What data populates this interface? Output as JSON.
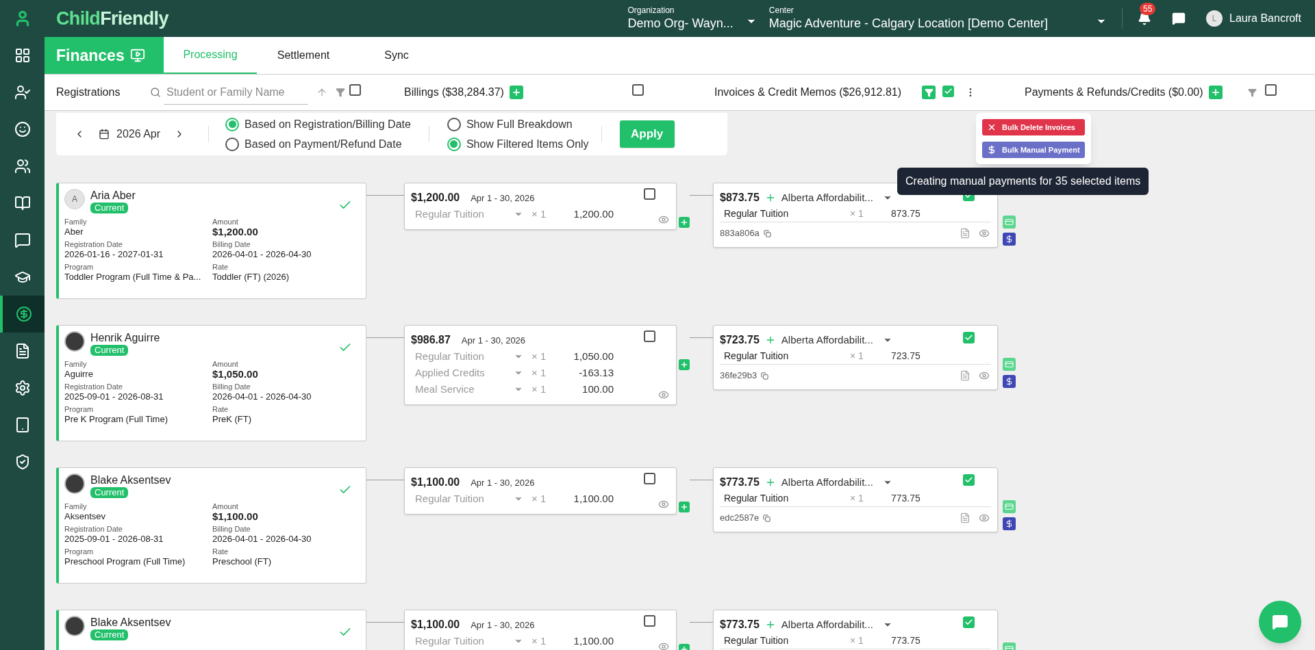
{
  "header": {
    "logo": {
      "first": "Child",
      "second": "Friendly"
    },
    "organization": {
      "label": "Organization",
      "value": "Demo Org- Wayn..."
    },
    "center": {
      "label": "Center",
      "value": "Magic Adventure - Calgary Location [Demo Center]"
    },
    "notifications": "55",
    "user": {
      "initial": "L",
      "name": "Laura Bancroft"
    }
  },
  "sidebar": {
    "items": [
      {
        "kind": "grid",
        "selected": false
      },
      {
        "kind": "user-check",
        "selected": false
      },
      {
        "kind": "smile",
        "selected": false
      },
      {
        "kind": "users",
        "selected": false
      },
      {
        "kind": "book",
        "selected": false
      },
      {
        "kind": "chat",
        "selected": false
      },
      {
        "kind": "graduation",
        "selected": false
      },
      {
        "kind": "dollar",
        "selected": true
      },
      {
        "kind": "document",
        "selected": false
      },
      {
        "kind": "settings",
        "selected": false
      },
      {
        "kind": "tablet",
        "selected": false
      },
      {
        "kind": "shield",
        "selected": false
      }
    ]
  },
  "section": {
    "title": "Finances",
    "tabs": [
      {
        "label": "Processing",
        "selected": true
      },
      {
        "label": "Settlement",
        "selected": false
      },
      {
        "label": "Sync",
        "selected": false
      }
    ]
  },
  "columns": {
    "registrations": {
      "title": "Registrations",
      "search_placeholder": "Student or Family Name",
      "checked": false
    },
    "billings": {
      "title": "Billings ($38,284.37)",
      "checked": false
    },
    "invoices": {
      "title": "Invoices & Credit Memos ($26,912.81)",
      "filter_active": true,
      "checked": true
    },
    "payments": {
      "title": "Payments & Refunds/Credits ($0.00)",
      "filter_active": false,
      "checked": false
    }
  },
  "filter": {
    "month": "2026 Apr",
    "date_basis": [
      {
        "label": "Based on Registration/Billing Date",
        "selected": true
      },
      {
        "label": "Based on Payment/Refund Date",
        "selected": false
      }
    ],
    "display": [
      {
        "label": "Show Full Breakdown",
        "selected": false
      },
      {
        "label": "Show Filtered Items Only",
        "selected": true
      }
    ],
    "apply": "Apply"
  },
  "menu": {
    "items": [
      {
        "kind": "delete",
        "label": "Bulk Delete Invoices"
      },
      {
        "kind": "payment",
        "label": "Bulk Manual Payment"
      }
    ],
    "tooltip": "Creating manual payments for 35 selected items"
  },
  "rows": [
    {
      "registration": {
        "name": "Aria Aber",
        "avatar": {
          "kind": "initial",
          "initial": "A"
        },
        "status": "Current",
        "fields": [
          {
            "label": "Family",
            "value": "Aber",
            "bold": false
          },
          {
            "label": "Amount",
            "value": "$1,200.00",
            "bold": true
          },
          {
            "label": "Registration Date",
            "value": "2026-01-16 - 2027-01-31",
            "bold": false
          },
          {
            "label": "Billing Date",
            "value": "2026-04-01 - 2026-04-30",
            "bold": false
          },
          {
            "label": "Program",
            "value": "Toddler Program (Full Time & Pa...",
            "bold": false
          },
          {
            "label": "Rate",
            "value": "Toddler (FT) (2026)",
            "bold": false
          }
        ]
      },
      "billing": {
        "amount": "$1,200.00",
        "period": "Apr 1 - 30, 2026",
        "checked": false,
        "lines": [
          {
            "name": "Regular Tuition",
            "qty": "× 1",
            "amount": "1,200.00"
          }
        ]
      },
      "invoice": {
        "amount": "$873.75",
        "provider": "Alberta Affordabilit...",
        "checked": true,
        "lines": [
          {
            "name": "Regular Tuition",
            "qty": "× 1",
            "amount": "873.75"
          }
        ],
        "id": "883a806a"
      }
    },
    {
      "registration": {
        "name": "Henrik Aguirre",
        "avatar": {
          "kind": "photo"
        },
        "status": "Current",
        "fields": [
          {
            "label": "Family",
            "value": "Aguirre",
            "bold": false
          },
          {
            "label": "Amount",
            "value": "$1,050.00",
            "bold": true
          },
          {
            "label": "Registration Date",
            "value": "2025-09-01 - 2026-08-31",
            "bold": false
          },
          {
            "label": "Billing Date",
            "value": "2026-04-01 - 2026-04-30",
            "bold": false
          },
          {
            "label": "Program",
            "value": "Pre K Program (Full Time)",
            "bold": false
          },
          {
            "label": "Rate",
            "value": "PreK (FT)",
            "bold": false
          }
        ]
      },
      "billing": {
        "amount": "$986.87",
        "period": "Apr 1 - 30, 2026",
        "checked": false,
        "lines": [
          {
            "name": "Regular Tuition",
            "qty": "× 1",
            "amount": "1,050.00"
          },
          {
            "name": "Applied Credits",
            "qty": "× 1",
            "amount": "-163.13"
          },
          {
            "name": "Meal Service",
            "qty": "× 1",
            "amount": "100.00"
          }
        ]
      },
      "invoice": {
        "amount": "$723.75",
        "provider": "Alberta Affordabilit...",
        "checked": true,
        "lines": [
          {
            "name": "Regular Tuition",
            "qty": "× 1",
            "amount": "723.75"
          }
        ],
        "id": "36fe29b3"
      }
    },
    {
      "registration": {
        "name": "Blake Aksentsev",
        "avatar": {
          "kind": "photo"
        },
        "status": "Current",
        "fields": [
          {
            "label": "Family",
            "value": "Aksentsev",
            "bold": false
          },
          {
            "label": "Amount",
            "value": "$1,100.00",
            "bold": true
          },
          {
            "label": "Registration Date",
            "value": "2025-09-01 - 2026-08-31",
            "bold": false
          },
          {
            "label": "Billing Date",
            "value": "2026-04-01 - 2026-04-30",
            "bold": false
          },
          {
            "label": "Program",
            "value": "Preschool Program (Full Time)",
            "bold": false
          },
          {
            "label": "Rate",
            "value": "Preschool (FT)",
            "bold": false
          }
        ]
      },
      "billing": {
        "amount": "$1,100.00",
        "period": "Apr 1 - 30, 2026",
        "checked": false,
        "lines": [
          {
            "name": "Regular Tuition",
            "qty": "× 1",
            "amount": "1,100.00"
          }
        ]
      },
      "invoice": {
        "amount": "$773.75",
        "provider": "Alberta Affordabilit...",
        "checked": true,
        "lines": [
          {
            "name": "Regular Tuition",
            "qty": "× 1",
            "amount": "773.75"
          }
        ],
        "id": "edc2587e"
      }
    },
    {
      "registration": {
        "name": "Blake Aksentsev",
        "avatar": {
          "kind": "photo"
        },
        "status": "Current"
      },
      "billing": {
        "amount": "$1,100.00",
        "period": "Apr 1 - 30, 2026",
        "checked": false,
        "lines": [
          {
            "name": "Regular Tuition",
            "qty": "× 1",
            "amount": "1,100.00"
          }
        ]
      },
      "invoice": {
        "amount": "$773.75",
        "provider": "Alberta Affordabilit...",
        "checked": true,
        "lines": [
          {
            "name": "Regular Tuition",
            "qty": "× 1",
            "amount": "773.75"
          }
        ]
      }
    }
  ]
}
